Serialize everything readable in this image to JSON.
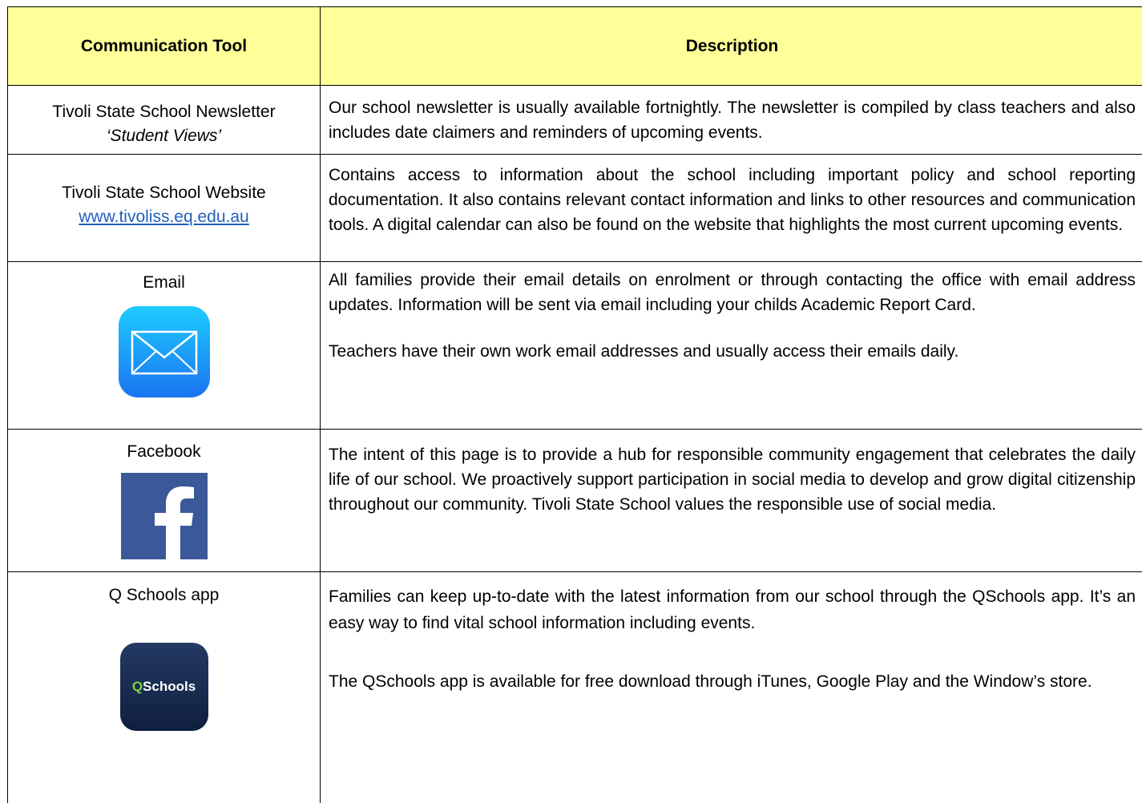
{
  "header": {
    "tool_label": "Communication Tool",
    "desc_label": "Description",
    "background": "#ffff99"
  },
  "rows": [
    {
      "tool_name": "Tivoli State School Newsletter",
      "tool_sub": "‘Student Views’",
      "description": "Our school newsletter is usually available fortnightly. The newsletter is compiled by class teachers and also includes date claimers and reminders of upcoming events."
    },
    {
      "tool_name": "Tivoli State School Website",
      "tool_link": "www.tivoliss.eq.edu.au",
      "description": "Contains access to information about the school including important policy and school reporting documentation. It also contains relevant contact information and links to other resources and communication tools. A digital calendar can also be found on the website that highlights the most current upcoming events."
    },
    {
      "tool_name": "Email",
      "icon": "mail-icon",
      "description": "All families provide their email details on enrolment or through contacting the office with email address updates. Information will be sent via email including your childs Academic Report Card.",
      "description_2": "Teachers have their own work email addresses and usually access their emails daily."
    },
    {
      "tool_name": "Facebook",
      "icon": "facebook-icon",
      "description": "The intent of this page is to provide a hub for responsible community engagement that celebrates the daily life of our school.  We proactively support participation in social media to develop and grow digital citizenship throughout our community.  Tivoli State School values the responsible use of social media."
    },
    {
      "tool_name": "Q Schools app",
      "icon": "qschools-icon",
      "icon_text_q": "Q",
      "icon_text_rest": "Schools",
      "description": "Families can keep up-to-date with the latest information from our school through the QSchools app. It’s an easy way to find vital school information including events.",
      "description_2": "The QSchools app is available for free download through iTunes, Google Play and the Window’s store."
    }
  ],
  "colors": {
    "link": "#1f5fbf",
    "mail_top": "#1ecbff",
    "mail_bottom": "#1a74f0",
    "facebook": "#3b5998",
    "qschools_bg": "#1a2d52",
    "qschools_q": "#7fd33a"
  }
}
